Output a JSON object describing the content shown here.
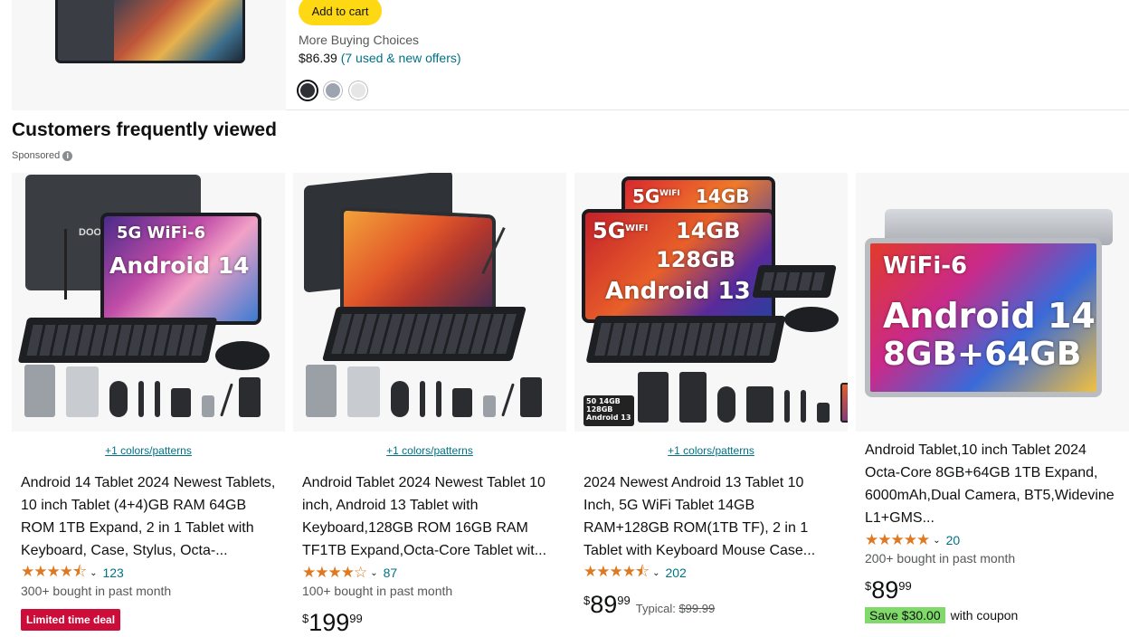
{
  "top_product": {
    "add_to_cart": "Add to cart",
    "more_buying_choices": "More Buying Choices",
    "price": "$86.39",
    "offers_link": "(7 used & new offers)",
    "swatches": [
      "#2e3035",
      "#9ea3b0",
      "#e6e6e6"
    ]
  },
  "section": {
    "title": "Customers frequently viewed",
    "sponsored": "Sponsored"
  },
  "products": [
    {
      "colors_link": "+1 colors/patterns",
      "title": "Android 14 Tablet 2024 Newest Tablets, 10 inch Tablet (4+4)GB RAM 64GB ROM 1TB Expand, 2 in 1 Tablet with Keyboard, Case, Stylus, Octa-...",
      "stars": "★★★★⯪",
      "rating_count": "123",
      "bought": "300+ bought in past month",
      "deal": "Limited time deal",
      "screen_text_1": "5G WiFi-6",
      "screen_text_2": "Android 14",
      "brand": "DOOG"
    },
    {
      "colors_link": "+1 colors/patterns",
      "title": "Android Tablet 2024 Newest Tablet 10 inch, Android 13 Tablet with Keyboard,128GB ROM 16GB RAM TF1TB Expand,Octa-Core Tablet wit...",
      "stars": "★★★★☆",
      "rating_count": "87",
      "bought": "100+ bought in past month",
      "price_symbol": "$",
      "price_whole": "199",
      "price_fraction": "99"
    },
    {
      "colors_link": "+1 colors/patterns",
      "title": "2024 Newest Android 13 Tablet 10 Inch, 5G WiFi Tablet 14GB RAM+128GB ROM(1TB TF), 2 in 1 Tablet with Keyboard Mouse Case...",
      "stars": "★★★★⯪",
      "rating_count": "202",
      "price_symbol": "$",
      "price_whole": "89",
      "price_fraction": "99",
      "typical_label": "Typical:",
      "typical_price": "$99.99",
      "screen_text_1": "5G",
      "screen_text_wifi": "WIFI",
      "screen_text_2": "14GB",
      "screen_text_3": "128GB",
      "screen_text_4": "Android 13",
      "back_text_1": "5G",
      "back_text_wifi": "WIFI",
      "back_text_2": "14GB",
      "mini_box_1": "50",
      "mini_box_2": "14GB",
      "mini_box_3": "128GB",
      "mini_box_4": "Android 13"
    },
    {
      "title": "Android Tablet,10 inch Tablet 2024 Octa-Core 8GB+64GB 1TB Expand, 6000mAh,Dual Camera, BT5,Widevine L1+GMS...",
      "stars": "★★★★★",
      "rating_count": "20",
      "bought": "200+ bought in past month",
      "price_symbol": "$",
      "price_whole": "89",
      "price_fraction": "99",
      "coupon_badge": "Save $30.00",
      "coupon_text": "with coupon",
      "screen_text_1": "WiFi-6",
      "screen_text_2": "Android 14",
      "screen_text_3": "8GB+64GB"
    }
  ],
  "colors": {
    "star": "#de7921",
    "link": "#007185",
    "deal_red": "#cc0c39",
    "coupon_green": "#7fda69",
    "add_to_cart_yellow": "#ffd814"
  }
}
